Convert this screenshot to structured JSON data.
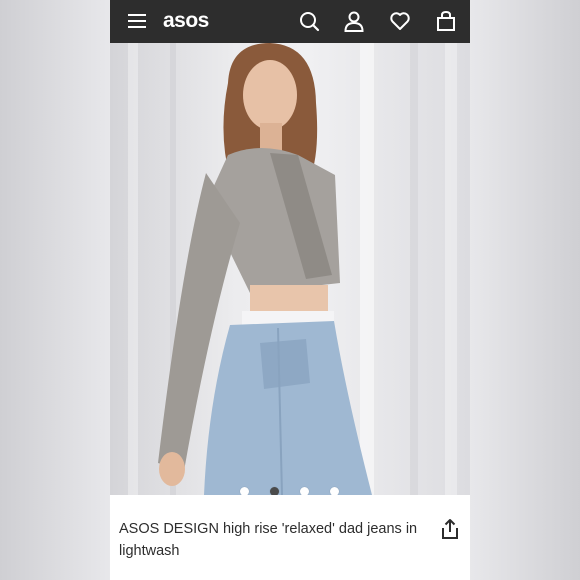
{
  "header": {
    "logo_text": "asos",
    "icons": [
      "menu-icon",
      "search-icon",
      "account-icon",
      "heart-icon",
      "bag-icon"
    ],
    "background": "#2d2d2d"
  },
  "product": {
    "title": "ASOS DESIGN high rise 'relaxed' dad jeans in lightwash",
    "image_count": 4,
    "active_image_index": 2
  },
  "actions": {
    "share_icon": "share-icon"
  }
}
